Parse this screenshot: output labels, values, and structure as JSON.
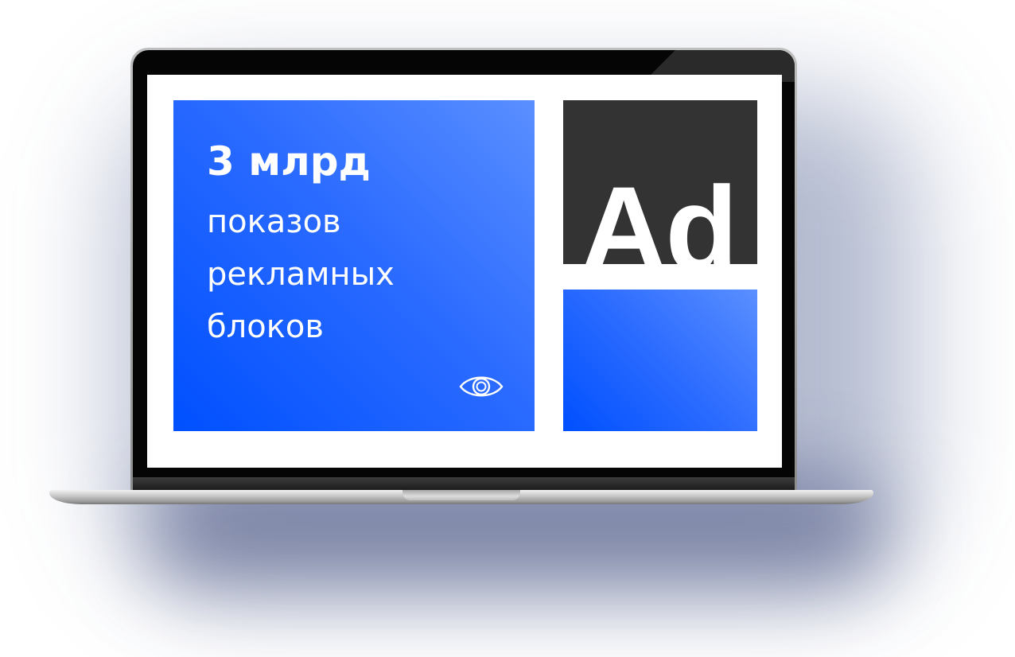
{
  "promo": {
    "headline": "3 млрд",
    "description_lines": [
      "показов",
      "рекламных",
      "блоков"
    ]
  },
  "ad_badge": {
    "text": "Ad"
  },
  "icons": {
    "eye": "eye-icon"
  },
  "colors": {
    "primary_blue": "#0050ff",
    "light_blue": "#5a8fff",
    "dark_card": "#333333",
    "screen_bg": "#ffffff"
  }
}
